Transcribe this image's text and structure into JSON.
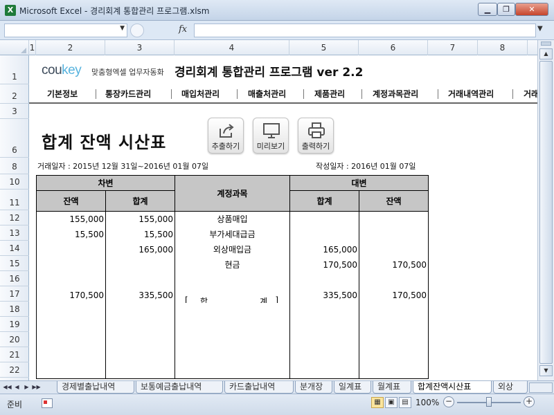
{
  "window": {
    "app_icon": "X",
    "title": "Microsoft Excel - 경리회계 통합관리 프로그램.xlsm",
    "min_label": "▁",
    "max_label": "❐",
    "close_label": "✕"
  },
  "formula_bar": {
    "namebox_arrow": "▼",
    "fx": "fx",
    "expand": "▼"
  },
  "columns": [
    "1",
    "2",
    "3",
    "4",
    "5",
    "6",
    "7",
    "8"
  ],
  "rows": [
    "1",
    "2",
    "3",
    "6",
    "8",
    "10",
    "11",
    "12",
    "13",
    "14",
    "15",
    "16",
    "17",
    "18",
    "19",
    "20",
    "21",
    "22"
  ],
  "brand": {
    "co": "cou",
    "key": "key",
    "tagline": "맞춤형엑셀 업무자동화"
  },
  "program_title": "경리회계 통합관리 프로그램 ver 2.2",
  "nav": [
    "기본정보",
    "통장카드관리",
    "매입처관리",
    "매출처관리",
    "제품관리",
    "계정과목관리",
    "거래내역관리",
    "거래"
  ],
  "report": {
    "title": "합계 잔액 시산표",
    "buttons": {
      "export": "추출하기",
      "preview": "미리보기",
      "print": "출력하기"
    },
    "transaction_period": "거래일자 : 2015년 12월 31일~2016년 01월 07일",
    "created_date": "작성일자 : 2016년 01월 07일"
  },
  "table": {
    "debit_header": "차변",
    "credit_header": "대변",
    "account_header": "계정과목",
    "balance": "잔액",
    "total": "합계",
    "rows": [
      {
        "d_bal": "155,000",
        "d_tot": "155,000",
        "account": "상품매입",
        "c_tot": "",
        "c_bal": ""
      },
      {
        "d_bal": "15,500",
        "d_tot": "15,500",
        "account": "부가세대급금",
        "c_tot": "",
        "c_bal": ""
      },
      {
        "d_bal": "",
        "d_tot": "165,000",
        "account": "외상매입금",
        "c_tot": "165,000",
        "c_bal": ""
      },
      {
        "d_bal": "",
        "d_tot": "",
        "account": "현금",
        "c_tot": "170,500",
        "c_bal": "170,500"
      },
      {
        "d_bal": "",
        "d_tot": "",
        "account": "",
        "c_tot": "",
        "c_bal": ""
      }
    ],
    "grand_total": {
      "d_bal": "170,500",
      "d_tot": "335,500",
      "bracket_l": "[",
      "label_1": "합",
      "label_2": "계",
      "bracket_r": "]",
      "c_tot": "335,500",
      "c_bal": "170,500"
    }
  },
  "sheet_tabs": [
    "경제별출납내역",
    "보통예금출납내역",
    "카드출납내역",
    "분개장",
    "일계표",
    "월계표",
    "합계잔액시산표",
    "외상"
  ],
  "active_tab": "합계잔액시산표",
  "tab_nav": [
    "◀◀",
    "◀",
    "▶",
    "▶▶"
  ],
  "status": {
    "ready": "준비",
    "zoom": "100%",
    "zoom_minus": "−",
    "zoom_plus": "+"
  },
  "colors": {
    "header_fill": "#c6c6c6",
    "brand_key": "#58b3de",
    "titlebar": "#c4d4e8"
  }
}
